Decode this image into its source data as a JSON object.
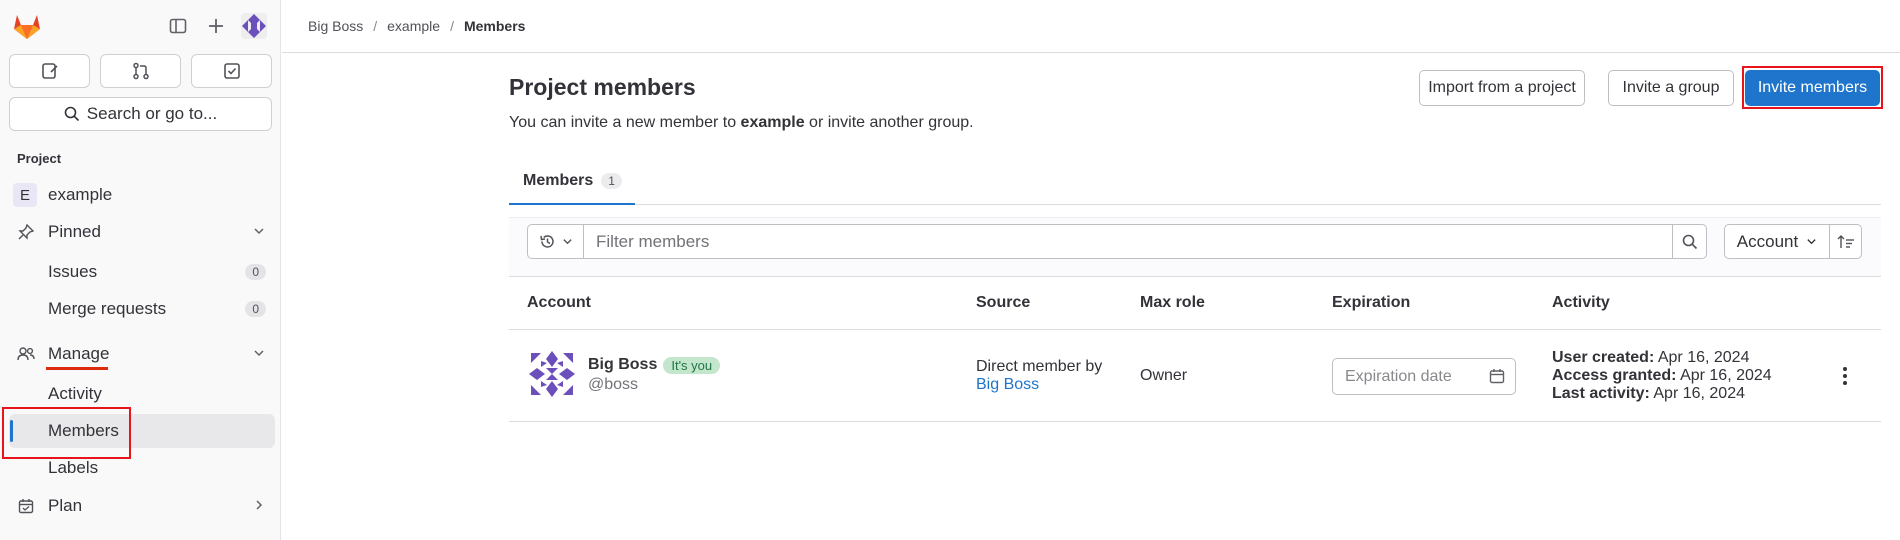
{
  "topbar": {
    "breadcrumb": [
      "Big Boss",
      "example",
      "Members"
    ]
  },
  "sidebar": {
    "search_label": "Search or go to...",
    "section_label": "Project",
    "project_initial": "E",
    "project_name": "example",
    "pinned_label": "Pinned",
    "issues_label": "Issues",
    "issues_count": "0",
    "mr_label": "Merge requests",
    "mr_count": "0",
    "manage_label": "Manage",
    "activity_label": "Activity",
    "members_label": "Members",
    "labels_label": "Labels",
    "plan_label": "Plan"
  },
  "header": {
    "title": "Project members",
    "subtitle_pre": "You can invite a new member to ",
    "subtitle_project": "example",
    "subtitle_post": " or invite another group.",
    "import_label": "Import from a project",
    "invite_group_label": "Invite a group",
    "invite_members_label": "Invite members"
  },
  "tabs": [
    {
      "label": "Members",
      "count": "1"
    }
  ],
  "filter": {
    "placeholder": "Filter members",
    "sort_label": "Account"
  },
  "table": {
    "columns": [
      "Account",
      "Source",
      "Max role",
      "Expiration",
      "Activity"
    ],
    "rows": [
      {
        "name": "Big Boss",
        "badge": "It's you",
        "username": "@boss",
        "source_text": "Direct member by",
        "source_link": "Big Boss",
        "role": "Owner",
        "expiration_placeholder": "Expiration date",
        "created_label": "User created:",
        "created_value": " Apr 16, 2024",
        "granted_label": "Access granted:",
        "granted_value": " Apr 16, 2024",
        "last_label": "Last activity:",
        "last_value": " Apr 16, 2024"
      }
    ]
  },
  "colors": {
    "accent": "#1f75cb",
    "highlight": "#e8141b"
  }
}
